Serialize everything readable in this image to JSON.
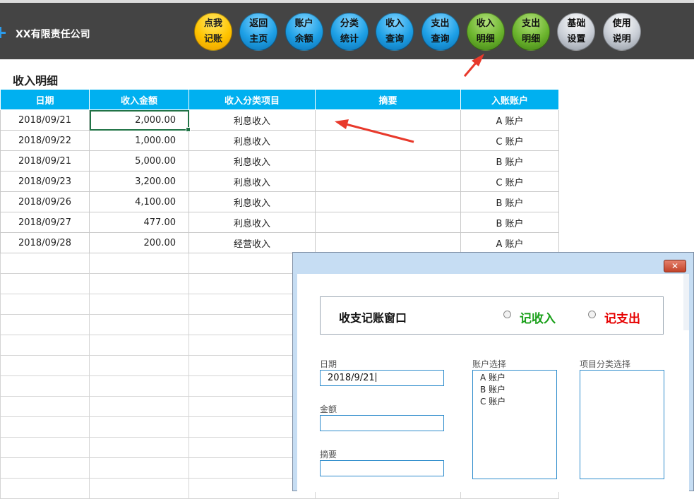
{
  "app": {
    "company": "XX有限责任公司"
  },
  "nav": [
    {
      "top": "点我",
      "bottom": "记账",
      "color": "yellow"
    },
    {
      "top": "返回",
      "bottom": "主页",
      "color": "blue"
    },
    {
      "top": "账户",
      "bottom": "余额",
      "color": "blue"
    },
    {
      "top": "分类",
      "bottom": "统计",
      "color": "blue"
    },
    {
      "top": "收入",
      "bottom": "查询",
      "color": "blue"
    },
    {
      "top": "支出",
      "bottom": "查询",
      "color": "blue"
    },
    {
      "top": "收入",
      "bottom": "明细",
      "color": "green"
    },
    {
      "top": "支出",
      "bottom": "明细",
      "color": "green"
    },
    {
      "top": "基础",
      "bottom": "设置",
      "color": "gray"
    },
    {
      "top": "使用",
      "bottom": "说明",
      "color": "gray"
    }
  ],
  "sheet": {
    "title": "收入明细",
    "headers": [
      "日期",
      "收入金额",
      "收入分类项目",
      "摘要",
      "入账账户"
    ],
    "rows": [
      [
        "2018/09/21",
        "2,000.00",
        "利息收入",
        "",
        "A 账户"
      ],
      [
        "2018/09/22",
        "1,000.00",
        "利息收入",
        "",
        "C 账户"
      ],
      [
        "2018/09/21",
        "5,000.00",
        "利息收入",
        "",
        "B 账户"
      ],
      [
        "2018/09/23",
        "3,200.00",
        "利息收入",
        "",
        "C 账户"
      ],
      [
        "2018/09/26",
        "4,100.00",
        "利息收入",
        "",
        "B 账户"
      ],
      [
        "2018/09/27",
        "477.00",
        "利息收入",
        "",
        "B 账户"
      ],
      [
        "2018/09/28",
        "200.00",
        "经营收入",
        "",
        "A 账户"
      ]
    ]
  },
  "dialog": {
    "close": "✕",
    "title": "收支记账窗口",
    "radio_income": "记收入",
    "radio_expense": "记支出",
    "income_color": "#1aa01a",
    "expense_color": "#e60000",
    "date_label": "日期",
    "date_value": "2018/9/21",
    "amount_label": "金额",
    "amount_value": "",
    "summary_label": "摘要",
    "summary_value": "",
    "account_label": "账户选择",
    "accounts": [
      "A 账户",
      "B 账户",
      "C 账户"
    ],
    "category_label": "项目分类选择",
    "categories": []
  }
}
